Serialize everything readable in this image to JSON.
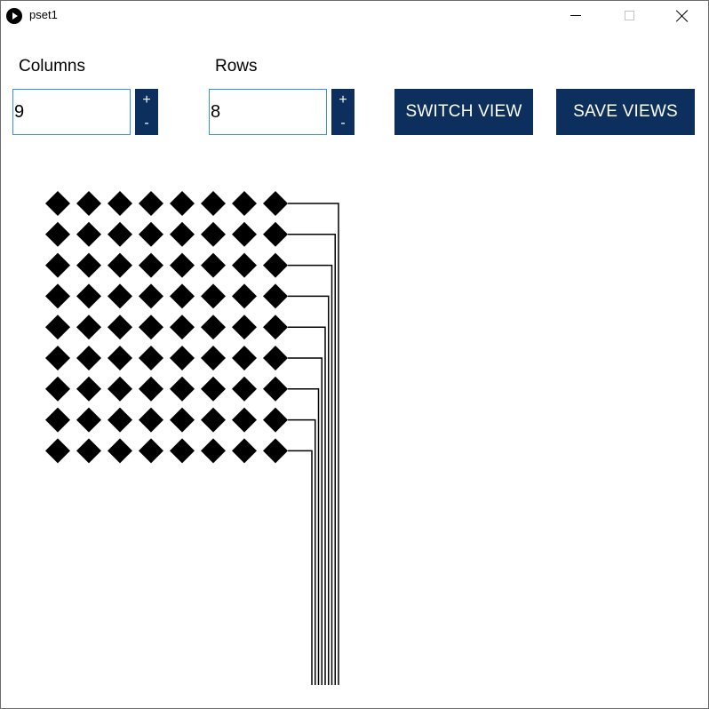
{
  "window": {
    "title": "pset1"
  },
  "controls": {
    "columns_label": "Columns",
    "rows_label": "Rows",
    "columns_value": "9",
    "rows_value": "8",
    "increment_label": "+",
    "decrement_label": "-",
    "switch_view_label": "SWITCH VIEW",
    "save_views_label": "SAVE VIEWS",
    "accent_color": "#0d2f5e",
    "input_border_color": "#3a8ee6"
  },
  "pattern": {
    "diamond_rows": 9,
    "diamonds_per_row": 8,
    "diamond_color": "#000000"
  }
}
